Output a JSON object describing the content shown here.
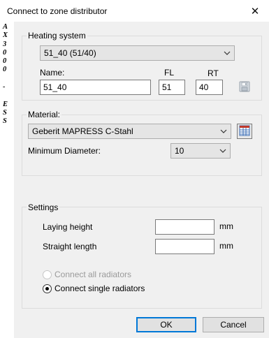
{
  "window": {
    "title": "Connect to zone distributor",
    "close_glyph": "✕"
  },
  "side_strip": {
    "chars": [
      "A",
      "X",
      "3",
      "0",
      "0",
      "0",
      "",
      "-",
      "",
      "E",
      "S",
      "S"
    ]
  },
  "heating_system": {
    "legend": "Heating system",
    "selected": "51_40 (51/40)",
    "name_label": "Name:",
    "fl_label": "FL",
    "rt_label": "RT",
    "name_value": "51_40",
    "fl_value": "51",
    "rt_value": "40",
    "save_icon": "floppy-disk-icon"
  },
  "material": {
    "legend": "Material:",
    "selected": "Geberit MAPRESS C-Stahl",
    "min_diameter_label": "Minimum Diameter:",
    "min_diameter_value": "10",
    "table_icon": "table-icon"
  },
  "settings": {
    "legend": "Settings",
    "laying_height_label": "Laying height",
    "laying_height_value": "",
    "laying_height_unit": "mm",
    "straight_length_label": "Straight length",
    "straight_length_value": "",
    "straight_length_unit": "mm",
    "connect_all_label": "Connect all radiators",
    "connect_single_label": "Connect single radiators",
    "connect_all_enabled": false,
    "selected_option": "connect_single"
  },
  "buttons": {
    "ok": "OK",
    "cancel": "Cancel"
  },
  "colors": {
    "default_button_border": "#0078d7",
    "dialog_background": "#f0f0f0",
    "table_icon_red": "#c0392b",
    "table_icon_blue": "#3d6fb5"
  }
}
